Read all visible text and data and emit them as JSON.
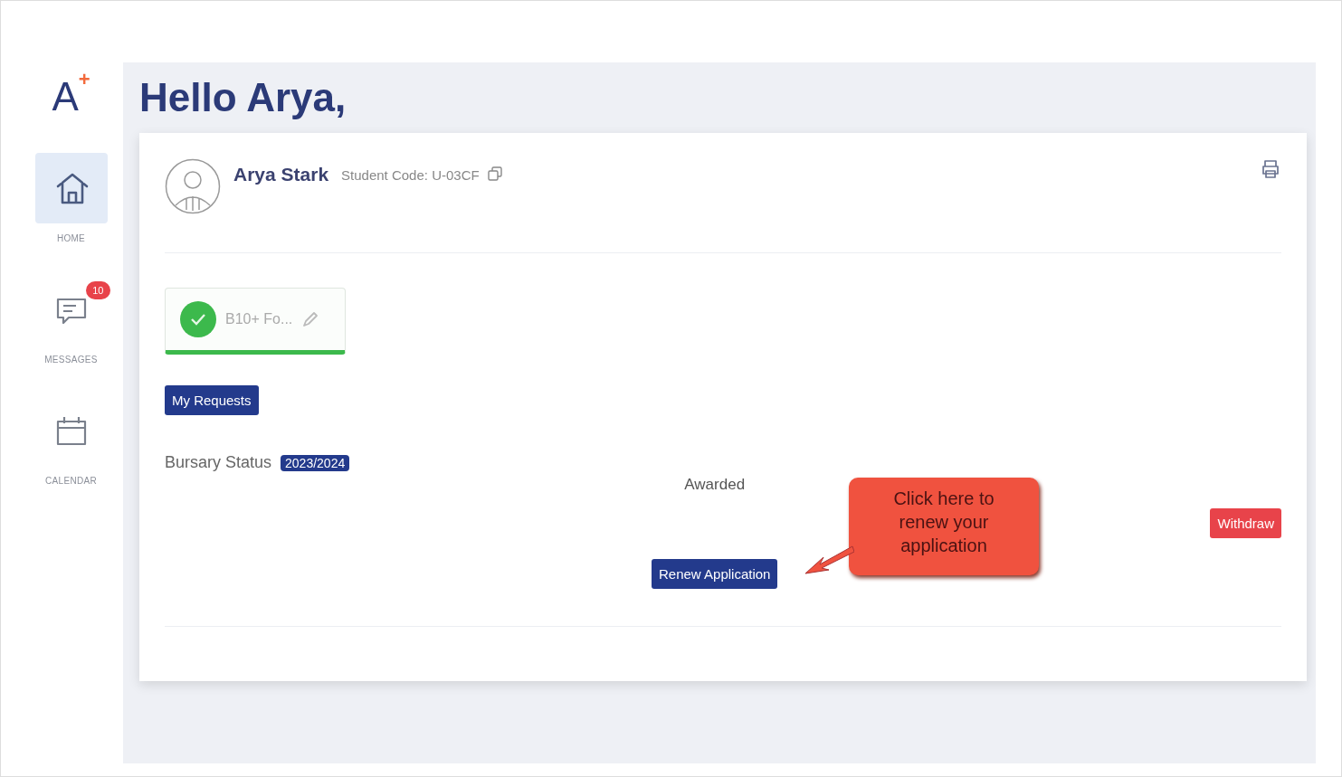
{
  "logo": {
    "letter": "A",
    "mark": "+"
  },
  "sidebar": {
    "items": [
      {
        "kind": "home",
        "label": "HOME",
        "selected": true
      },
      {
        "kind": "messages",
        "label": "MESSAGES",
        "selected": false,
        "badge": "10"
      },
      {
        "kind": "calendar",
        "label": "CALENDAR",
        "selected": false
      }
    ]
  },
  "greeting": "Hello Arya,",
  "profile": {
    "name": "Arya Stark",
    "student_code": "Student Code: U-03CF"
  },
  "form_chip": {
    "label": "B10+ Fo...",
    "complete": true
  },
  "my_requests_button": "My Requests",
  "bursary": {
    "label": "Bursary Status",
    "year": "2023/2024",
    "status": "Awarded",
    "renew_button": "Renew Application",
    "withdraw_button": "Withdraw"
  },
  "callout": "Click here to renew your application"
}
